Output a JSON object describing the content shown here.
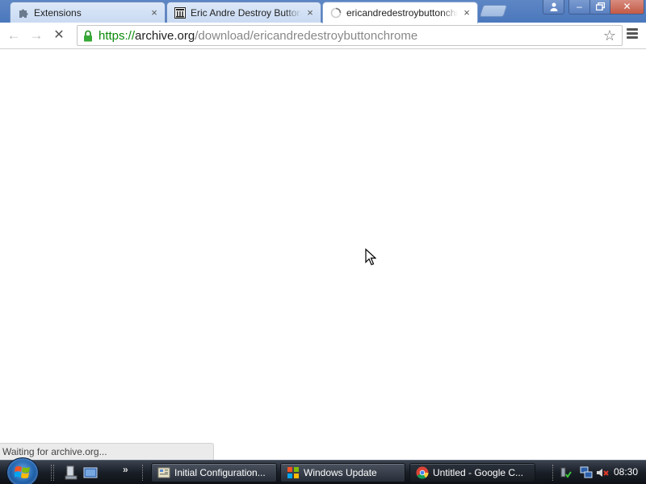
{
  "tabs": [
    {
      "title": "Extensions",
      "icon": "puzzle-icon",
      "close": "×",
      "active": false
    },
    {
      "title": "Eric Andre Destroy Button Chrome",
      "icon": "archive-temple-icon",
      "close": "×",
      "active": false
    },
    {
      "title": "ericandredestroybuttonchrome",
      "icon": "loading-spinner-icon",
      "close": "×",
      "active": true
    }
  ],
  "window_controls": {
    "profile": "person-icon",
    "minimize": "–",
    "maximize": "restore-icon",
    "close": "✕"
  },
  "toolbar": {
    "back": "←",
    "forward": "→",
    "stop": "✕",
    "star": "☆",
    "url": {
      "scheme": "https://",
      "host": "archive.org",
      "path": "/download/ericandredestroybuttonchrome"
    }
  },
  "status": "Waiting for archive.org...",
  "taskbar": {
    "quicklaunch_more": "»",
    "tasks": [
      {
        "label": "Initial Configuration...",
        "icon": "config-icon",
        "active": false
      },
      {
        "label": "Windows Update",
        "icon": "windows-update-icon",
        "active": false
      },
      {
        "label": "Untitled - Google C...",
        "icon": "chrome-icon",
        "active": true
      }
    ],
    "clock": "08:30"
  },
  "colors": {
    "secure_green": "#0a8b0a",
    "tabstrip": "#4b78bd",
    "taskbar": "#1a1f27"
  }
}
